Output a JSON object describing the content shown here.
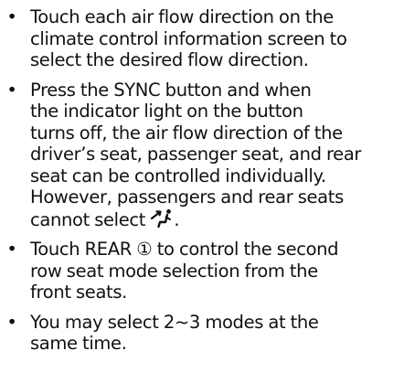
{
  "bullet_symbol": "•",
  "items": [
    {
      "lines": [
        "Touch each air flow direction on the",
        "climate control information screen to",
        "select the desired flow direction."
      ]
    },
    {
      "lines": [
        "Press the SYNC button and when",
        "the indicator light on the button",
        "turns off, the air flow direction of the",
        "driver’s seat, passenger seat, and rear",
        "seat can be controlled individually.",
        "However, passengers and rear seats"
      ],
      "last_line_before_icon": "cannot select",
      "last_line_after_icon": ".",
      "icon": "seat-airflow-icon"
    },
    {
      "lines": [
        "Touch REAR ① to control the second",
        "row seat mode selection from the",
        "front seats."
      ]
    },
    {
      "lines": [
        "You may select 2~3 modes at the",
        "same time."
      ]
    }
  ]
}
